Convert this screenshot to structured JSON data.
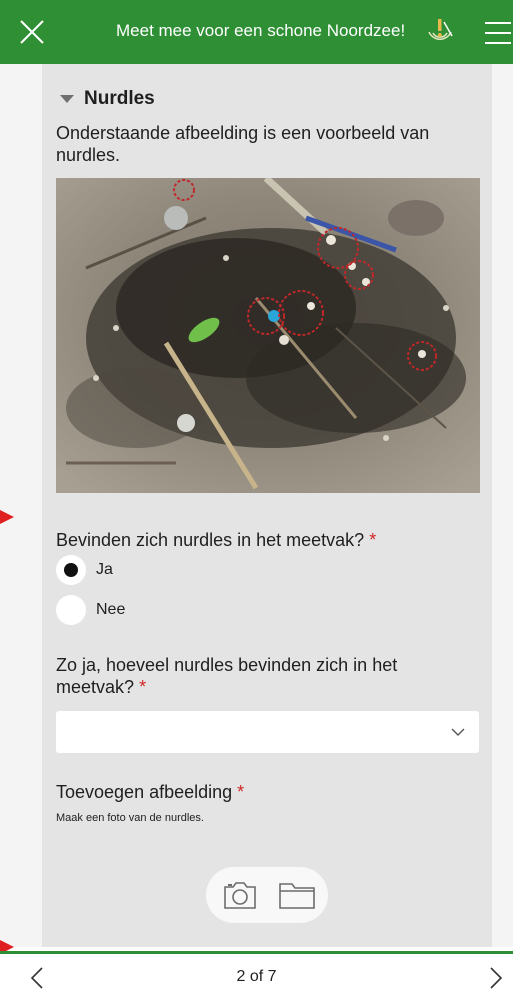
{
  "header": {
    "title": "Meet mee voor een schone Noordzee!",
    "close_icon": "close-icon",
    "gps_icon": "gps-warning-icon",
    "menu_icon": "hamburger-menu-icon"
  },
  "section": {
    "title": "Nurdles",
    "description": "Onderstaande afbeelding is een voorbeeld van nurdles."
  },
  "question1": {
    "label": "Bevinden zich nurdles in het meetvak?",
    "required": "*",
    "options": [
      {
        "label": "Ja",
        "selected": true
      },
      {
        "label": "Nee",
        "selected": false
      }
    ]
  },
  "question2": {
    "label": "Zo ja, hoeveel nurdles bevinden zich in het meetvak?",
    "required": "*",
    "selected_value": ""
  },
  "question3": {
    "label": "Toevoegen afbeelding",
    "required": "*",
    "hint": "Maak een foto van de nurdles."
  },
  "footer": {
    "page": "2 of 7"
  },
  "colors": {
    "brand": "#2f8f35",
    "required": "#d12626",
    "card": "#e4e4e4"
  }
}
